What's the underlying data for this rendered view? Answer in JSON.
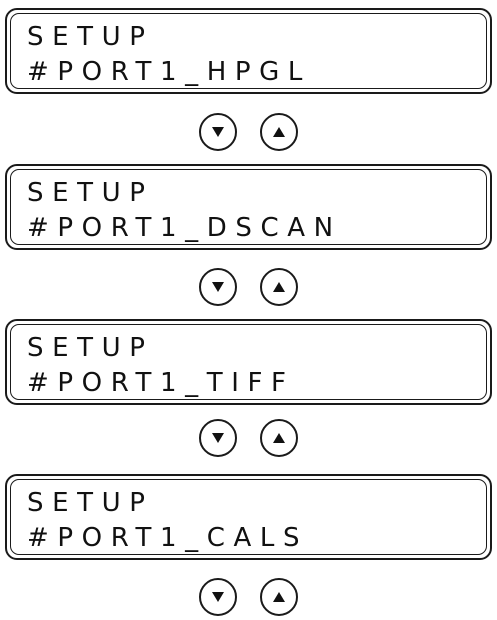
{
  "screens": [
    {
      "line1": "SETUP",
      "line2": "#PORT1_HPGL"
    },
    {
      "line1": "SETUP",
      "line2": "#PORT1_DSCAN"
    },
    {
      "line1": "SETUP",
      "line2": "#PORT1_TIFF"
    },
    {
      "line1": "SETUP",
      "line2": "#PORT1_CALS"
    }
  ],
  "keys": {
    "down_icon": "down-triangle-icon",
    "up_icon": "up-triangle-icon"
  }
}
